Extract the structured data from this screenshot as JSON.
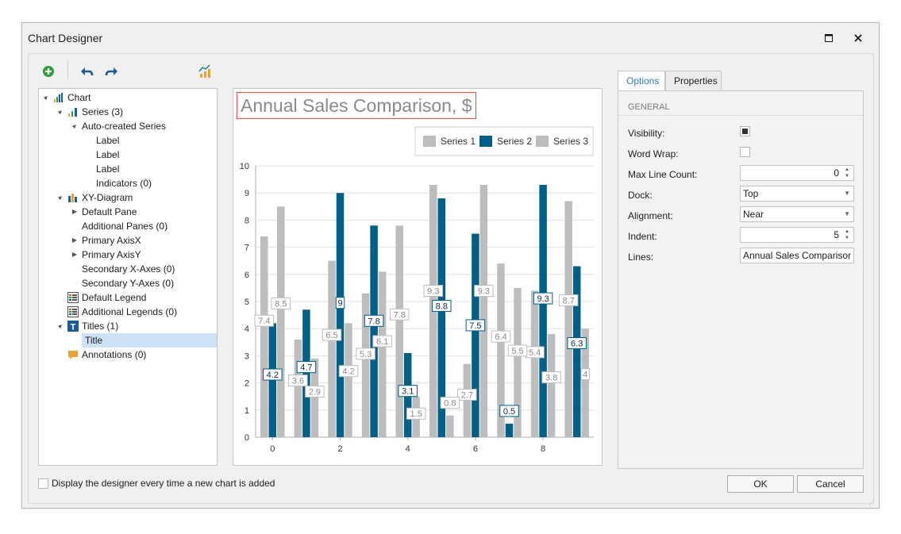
{
  "window": {
    "title": "Chart Designer"
  },
  "toolbar": {
    "add_icon": "add-icon",
    "undo_icon": "undo-icon",
    "redo_icon": "redo-icon",
    "wizard_icon": "chart-wizard-icon"
  },
  "tree": [
    {
      "label": "Chart",
      "level": 0,
      "expander": "▲",
      "icon": "chart"
    },
    {
      "label": "Series (3)",
      "level": 1,
      "expander": "▲",
      "icon": "series"
    },
    {
      "label": "Auto-created Series",
      "level": 2,
      "expander": "▲",
      "icon": ""
    },
    {
      "label": "Label",
      "level": 3,
      "expander": "",
      "icon": ""
    },
    {
      "label": "Label",
      "level": 3,
      "expander": "",
      "icon": ""
    },
    {
      "label": "Label",
      "level": 3,
      "expander": "",
      "icon": ""
    },
    {
      "label": "Indicators (0)",
      "level": 3,
      "expander": "",
      "icon": ""
    },
    {
      "label": "XY-Diagram",
      "level": 1,
      "expander": "▲",
      "icon": "diagram"
    },
    {
      "label": "Default Pane",
      "level": 2,
      "expander": "▶",
      "icon": ""
    },
    {
      "label": "Additional Panes (0)",
      "level": 2,
      "expander": "",
      "icon": ""
    },
    {
      "label": "Primary AxisX",
      "level": 2,
      "expander": "▶",
      "icon": ""
    },
    {
      "label": "Primary AxisY",
      "level": 2,
      "expander": "▶",
      "icon": ""
    },
    {
      "label": "Secondary X-Axes (0)",
      "level": 2,
      "expander": "",
      "icon": ""
    },
    {
      "label": "Secondary Y-Axes (0)",
      "level": 2,
      "expander": "",
      "icon": ""
    },
    {
      "label": "Default Legend",
      "level": 1,
      "expander": "",
      "icon": "legend"
    },
    {
      "label": "Additional Legends (0)",
      "level": 1,
      "expander": "",
      "icon": "legend"
    },
    {
      "label": "Titles (1)",
      "level": 1,
      "expander": "▲",
      "icon": "titles"
    },
    {
      "label": "Title",
      "level": 2,
      "expander": "",
      "icon": "",
      "selected": true
    },
    {
      "label": "Annotations (0)",
      "level": 1,
      "expander": "",
      "icon": "annotation"
    }
  ],
  "chart_data": {
    "type": "bar",
    "title": "Annual Sales Comparison, $",
    "x": [
      0,
      1,
      2,
      3,
      4,
      5,
      6,
      7,
      8,
      9
    ],
    "x_tick_labels": [
      "0",
      "2",
      "4",
      "6",
      "8"
    ],
    "y_tick_labels": [
      "0",
      "1",
      "2",
      "3",
      "4",
      "5",
      "6",
      "7",
      "8",
      "9",
      "10"
    ],
    "ylim": [
      0,
      10
    ],
    "grid": true,
    "legend_position": "top-right",
    "series": [
      {
        "name": "Series 1",
        "color": "#bdbdbd",
        "values": [
          7.4,
          3.6,
          6.5,
          5.3,
          7.8,
          9.3,
          2.7,
          6.4,
          5.4,
          8.7
        ]
      },
      {
        "name": "Series 2",
        "color": "#005f85",
        "values": [
          4.2,
          4.7,
          9,
          7.8,
          3.1,
          8.8,
          7.5,
          0.5,
          9.3,
          6.3
        ]
      },
      {
        "name": "Series 3",
        "color": "#bdbdbd",
        "values": [
          8.5,
          2.9,
          4.2,
          6.1,
          1.5,
          0.8,
          9.3,
          5.5,
          3.8,
          4
        ]
      }
    ]
  },
  "tabs": {
    "options": "Options",
    "properties": "Properties"
  },
  "options": {
    "group": "GENERAL",
    "visibility_label": "Visibility:",
    "visibility_checked": true,
    "wordwrap_label": "Word Wrap:",
    "wordwrap_checked": false,
    "maxline_label": "Max Line Count:",
    "maxline_value": "0",
    "dock_label": "Dock:",
    "dock_value": "Top",
    "alignment_label": "Alignment:",
    "alignment_value": "Near",
    "indent_label": "Indent:",
    "indent_value": "5",
    "lines_label": "Lines:",
    "lines_value": "Annual Sales Comparison, $"
  },
  "footer": {
    "show_designer_label": "Display the designer every time a new chart is added",
    "show_designer_checked": false,
    "ok_label": "OK",
    "cancel_label": "Cancel"
  }
}
